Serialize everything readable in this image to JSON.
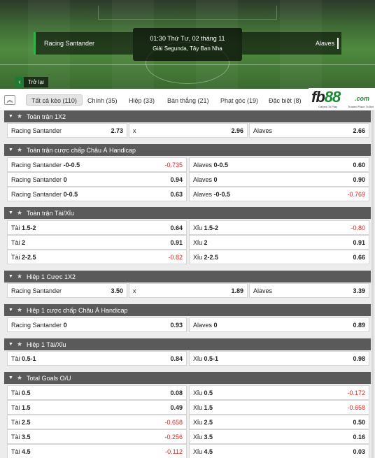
{
  "match": {
    "home": "Racing Santander",
    "away": "Alaves",
    "time": "01:30 Thứ Tư, 02 tháng 11",
    "league": "Giải Segunda, Tây Ban Nha",
    "back_label": "Trở lại"
  },
  "tabs": [
    {
      "label": "Tất cả kèo (110)",
      "active": true
    },
    {
      "label": "Chính (35)"
    },
    {
      "label": "Hiệp (33)"
    },
    {
      "label": "Bàn thắng (21)"
    },
    {
      "label": "Phạt góc (19)"
    },
    {
      "label": "Đặc biệt (8)"
    }
  ],
  "logo": {
    "brand_a": "fb",
    "brand_b": "88",
    "domain": ".com",
    "tagline_a": "Games To Play",
    "tagline_b": "Trusted Place To Bet"
  },
  "sections": {
    "s1": {
      "title": "Toàn trận 1X2",
      "cells": [
        [
          "Racing Santander",
          "2.73"
        ],
        [
          "x",
          "2.96"
        ],
        [
          "Alaves",
          "2.66"
        ]
      ]
    },
    "s2": {
      "title": "Toàn trận cược chấp Châu Á Handicap",
      "rows": [
        [
          [
            "Racing Santander",
            "-0-0.5",
            "-0.735"
          ],
          [
            "Alaves",
            "0-0.5",
            "0.60"
          ]
        ],
        [
          [
            "Racing Santander",
            "0",
            "0.94"
          ],
          [
            "Alaves",
            "0",
            "0.90"
          ]
        ],
        [
          [
            "Racing Santander",
            "0-0.5",
            "0.63"
          ],
          [
            "Alaves",
            "-0-0.5",
            "-0.769"
          ]
        ]
      ]
    },
    "s3": {
      "title": "Toàn trận Tài/Xỉu",
      "rows": [
        [
          [
            "Tài",
            "1.5-2",
            "0.64"
          ],
          [
            "Xỉu",
            "1.5-2",
            "-0.80"
          ]
        ],
        [
          [
            "Tài",
            "2",
            "0.91"
          ],
          [
            "Xỉu",
            "2",
            "0.91"
          ]
        ],
        [
          [
            "Tài",
            "2-2.5",
            "-0.82"
          ],
          [
            "Xỉu",
            "2-2.5",
            "0.66"
          ]
        ]
      ]
    },
    "s4": {
      "title": "Hiệp 1 Cược 1X2",
      "cells": [
        [
          "Racing Santander",
          "3.50"
        ],
        [
          "x",
          "1.89"
        ],
        [
          "Alaves",
          "3.39"
        ]
      ]
    },
    "s5": {
      "title": "Hiệp 1 cược chấp Châu Á Handicap",
      "rows": [
        [
          [
            "Racing Santander",
            "0",
            "0.93"
          ],
          [
            "Alaves",
            "0",
            "0.89"
          ]
        ]
      ]
    },
    "s6": {
      "title": "Hiệp 1 Tài/Xỉu",
      "rows": [
        [
          [
            "Tài",
            "0.5-1",
            "0.84"
          ],
          [
            "Xỉu",
            "0.5-1",
            "0.98"
          ]
        ]
      ]
    },
    "s7": {
      "title": "Total Goals O/U",
      "rows": [
        [
          [
            "Tài",
            "0.5",
            "0.08"
          ],
          [
            "Xỉu",
            "0.5",
            "-0.172"
          ]
        ],
        [
          [
            "Tài",
            "1.5",
            "0.49"
          ],
          [
            "Xỉu",
            "1.5",
            "-0.658"
          ]
        ],
        [
          [
            "Tài",
            "2.5",
            "-0.658"
          ],
          [
            "Xỉu",
            "2.5",
            "0.50"
          ]
        ],
        [
          [
            "Tài",
            "3.5",
            "-0.256"
          ],
          [
            "Xỉu",
            "3.5",
            "0.16"
          ]
        ],
        [
          [
            "Tài",
            "4.5",
            "-0.112"
          ],
          [
            "Xỉu",
            "4.5",
            "0.03"
          ]
        ]
      ]
    }
  },
  "colors": {
    "negative_odd": "#e0201a",
    "brand_green": "#1e8a35",
    "section_header": "#5a5a5a"
  }
}
